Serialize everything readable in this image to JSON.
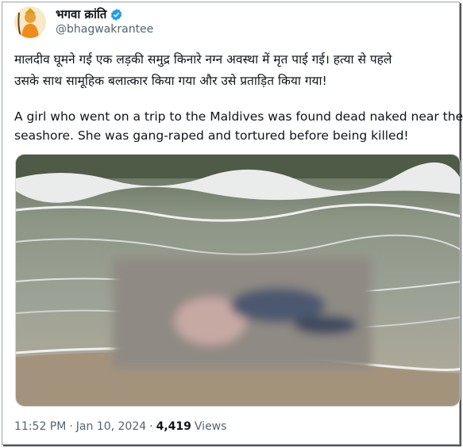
{
  "tweet": {
    "display_name": "भगवा क्रांति",
    "handle": "@bhagwakrantee",
    "text_hindi_line1": "मालदीव घूमने गई एक लड़की समुद्र किनारे नग्न अवस्था में मृत पाई गई। हत्या से पहले",
    "text_hindi_line2": "उसके साथ सामूहिक बलात्कार किया गया और उसे प्रताड़ित किया गया!",
    "text_english_line1": "A girl who went on a trip  to the Maldives was found dead naked near the",
    "text_english_line2": "seashore. She was gang-raped and tortured before being killed!",
    "time": "11:52 PM",
    "date": "Jan 10, 2024",
    "views_count": "4,419",
    "views_label": "Views",
    "separator": "·"
  },
  "icons": {
    "avatar": "deity-avatar",
    "verified": "verified-badge-icon"
  },
  "colors": {
    "verified_blue": "#1d9bf0",
    "text_primary": "#0f1419",
    "text_secondary": "#536471"
  }
}
